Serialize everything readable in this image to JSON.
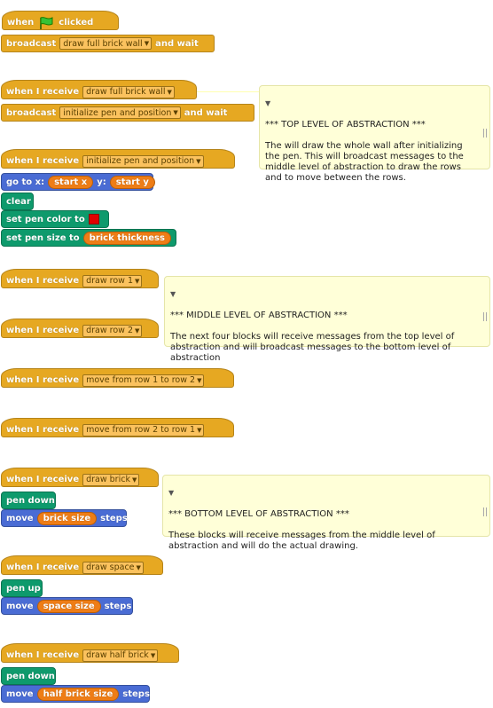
{
  "scripts": {
    "green_flag": {
      "hat_when": "when",
      "hat_clicked": "clicked",
      "broadcast_label": "broadcast",
      "broadcast_value": "draw full brick wall",
      "and_wait": "and wait"
    },
    "full_wall": {
      "hat_label": "when I receive",
      "hat_value": "draw full brick wall",
      "broadcast_label": "broadcast",
      "broadcast_value": "initialize pen and position",
      "and_wait": "and wait"
    },
    "init": {
      "hat_label": "when I receive",
      "hat_value": "initialize pen and position",
      "goto_label_x": "go to x:",
      "goto_x": "start x",
      "goto_label_y": "y:",
      "goto_y": "start y",
      "clear_label": "clear",
      "set_color_label": "set pen color to",
      "pen_color": "#e00000",
      "set_size_label": "set pen size to",
      "size_value": "brick thickness"
    },
    "row1": {
      "hat_label": "when I receive",
      "hat_value": "draw row 1"
    },
    "row2": {
      "hat_label": "when I receive",
      "hat_value": "draw row 2"
    },
    "move12": {
      "hat_label": "when I receive",
      "hat_value": "move from row 1 to row 2"
    },
    "move21": {
      "hat_label": "when I receive",
      "hat_value": "move from row 2 to row 1"
    },
    "brick": {
      "hat_label": "when I receive",
      "hat_value": "draw brick",
      "pen_label": "pen down",
      "move_label": "move",
      "move_value": "brick size",
      "steps_label": "steps"
    },
    "space": {
      "hat_label": "when I receive",
      "hat_value": "draw space",
      "pen_label": "pen up",
      "move_label": "move",
      "move_value": "space size",
      "steps_label": "steps"
    },
    "half": {
      "hat_label": "when I receive",
      "hat_value": "draw half brick",
      "pen_label": "pen down",
      "move_label": "move",
      "move_value": "half brick size",
      "steps_label": "steps"
    }
  },
  "comments": {
    "top": "*** TOP LEVEL OF ABSTRACTION ***\n\nThe will draw the whole wall after initializing the pen. This will broadcast messages to the middle level of abstraction to draw the rows and to move between the rows.",
    "middle": "*** MIDDLE LEVEL OF ABSTRACTION ***\n\nThe next four blocks will receive messages from the top level of abstraction and will broadcast messages to the bottom level of abstraction",
    "bottom": "*** BOTTOM LEVEL OF ABSTRACTION ***\n\nThese blocks will receive messages from the middle level of abstraction and will do the actual drawing."
  },
  "colors": {
    "control": "#e6a822",
    "motion": "#4a6cd4",
    "pen": "#0e9a6c",
    "reporter": "#ee7d16",
    "comment": "#ffffd8"
  }
}
